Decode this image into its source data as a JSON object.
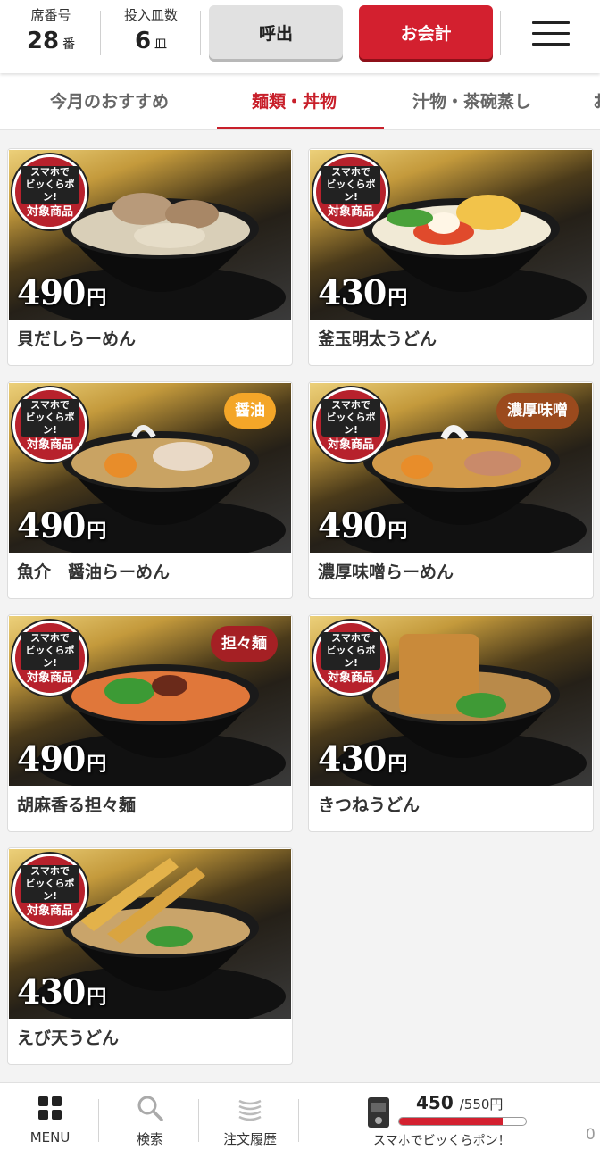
{
  "header": {
    "seat_label": "席番号",
    "seat_value": "28",
    "seat_unit": "番",
    "plates_label": "投入皿数",
    "plates_value": "6",
    "plates_unit": "皿",
    "call_button": "呼出",
    "pay_button": "お会計"
  },
  "tabs": [
    {
      "label": "今月のおすすめ",
      "active": false
    },
    {
      "label": "麺類・丼物",
      "active": true
    },
    {
      "label": "汁物・茶碗蒸し",
      "active": false
    },
    {
      "label": "お",
      "active": false
    }
  ],
  "badge_text": {
    "line1": "スマホで",
    "line2": "ビッくらポン!",
    "line3": "対象商品"
  },
  "currency": "円",
  "items": [
    {
      "name": "貝だしらーめん",
      "price": "490",
      "tag": null
    },
    {
      "name": "釜玉明太うどん",
      "price": "430",
      "tag": null
    },
    {
      "name": "魚介　醤油らーめん",
      "price": "490",
      "tag": "醤油"
    },
    {
      "name": "濃厚味噌らーめん",
      "price": "490",
      "tag": "濃厚味噌"
    },
    {
      "name": "胡麻香る担々麺",
      "price": "490",
      "tag": "担々麺"
    },
    {
      "name": "きつねうどん",
      "price": "430",
      "tag": null
    },
    {
      "name": "えび天うどん",
      "price": "430",
      "tag": null
    }
  ],
  "bottom_nav": {
    "menu": "MENU",
    "search": "検索",
    "history": "注文履歴",
    "points_current": "450",
    "points_total": "/550円",
    "points_progress": 0.818,
    "points_note": "スマホでビッくらポン！",
    "edge_digit": "0"
  },
  "colors": {
    "accent": "#d3202f",
    "tab_active": "#c8202b"
  }
}
